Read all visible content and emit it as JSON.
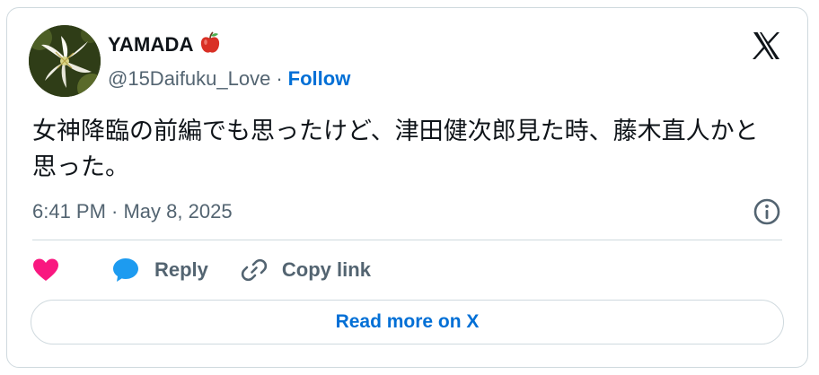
{
  "user": {
    "display_name": "YAMADA",
    "emoji_icon": "apple-icon",
    "handle": "@15Daifuku_Love",
    "separator": "·",
    "follow_label": "Follow",
    "avatar_icon": "white-lily-flower"
  },
  "tweet": {
    "text": "女神降臨の前編でも思ったけど、津田健次郎見た時、藤木直人かと思った。",
    "timestamp": "6:41 PM · May 8, 2025"
  },
  "actions": {
    "like_icon": "heart-icon",
    "reply_icon": "speech-bubble-icon",
    "reply_label": "Reply",
    "copy_icon": "link-icon",
    "copy_label": "Copy link"
  },
  "footer": {
    "read_more_label": "Read more on X"
  },
  "colors": {
    "link_blue": "#006fd6",
    "heart_pink": "#f91880",
    "reply_blue": "#1d9bf0",
    "muted_gray": "#536471",
    "border": "#cfd9de",
    "apple_red": "#d93025"
  }
}
